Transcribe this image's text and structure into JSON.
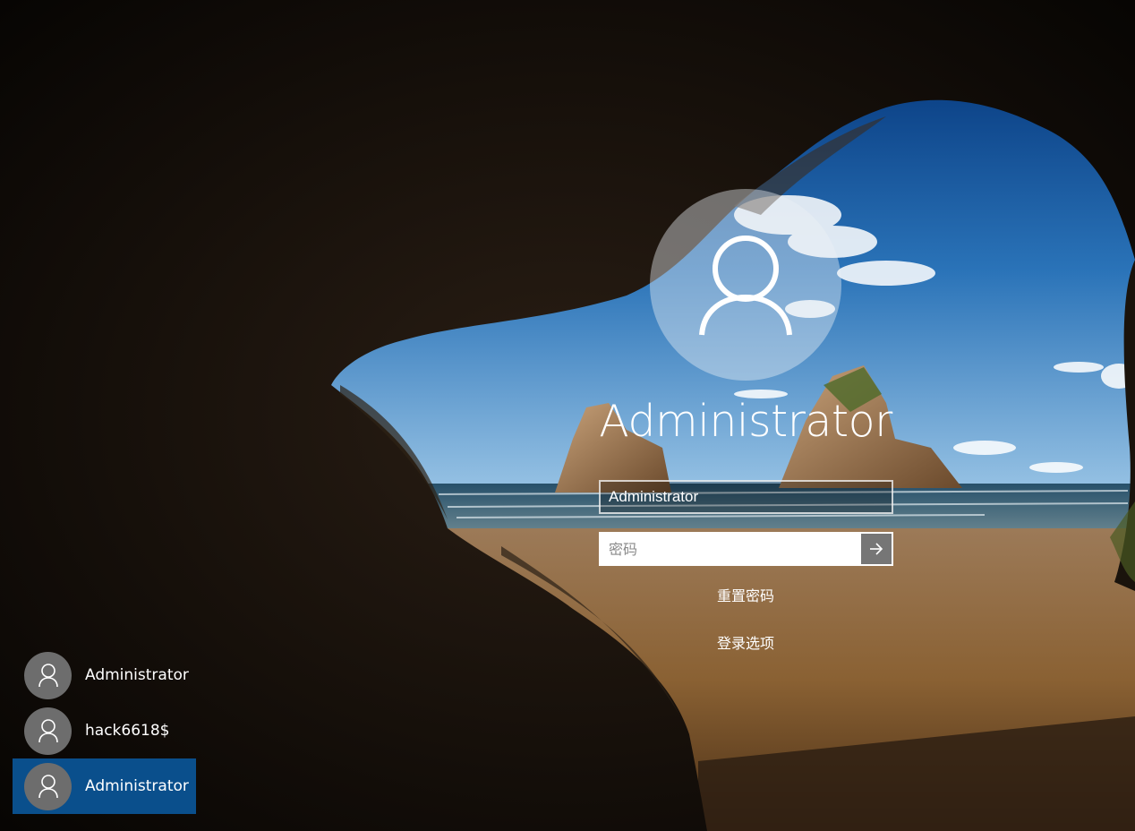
{
  "login": {
    "display_name": "Administrator",
    "username_value": "Administrator",
    "password_placeholder": "密码",
    "reset_password_label": "重置密码",
    "signin_options_label": "登录选项"
  },
  "accounts": [
    {
      "name": "Administrator",
      "selected": false
    },
    {
      "name": "hack6618$",
      "selected": false
    },
    {
      "name": "Administrator",
      "selected": true
    }
  ],
  "icons": {
    "user": "person-outline-icon",
    "submit": "arrow-right-icon"
  },
  "colors": {
    "selected_account": "#0a4f8c",
    "submit_button": "#767676",
    "avatar_small": "#6d6d6d"
  }
}
